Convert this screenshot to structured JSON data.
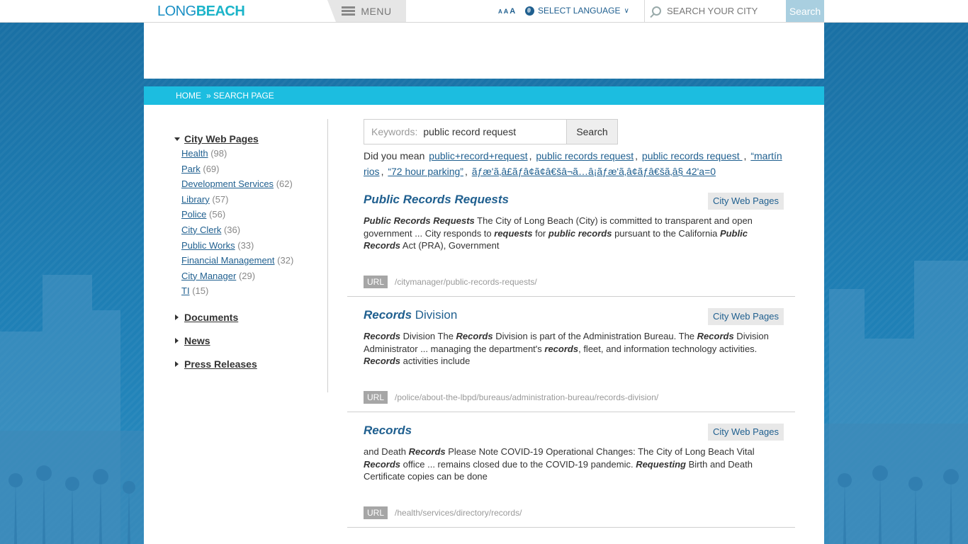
{
  "header": {
    "logo_part1": "LONG",
    "logo_part2": "BEACH",
    "menu_label": "MENU",
    "text_size": [
      "A",
      "A",
      "A"
    ],
    "language_label": "SELECT LANGUAGE",
    "search_placeholder": "SEARCH YOUR CITY",
    "search_button": "Search"
  },
  "breadcrumb": {
    "home": "HOME",
    "current": "» SEARCH PAGE"
  },
  "sidebar": {
    "facets": [
      {
        "label": "City Web Pages",
        "expanded": true,
        "items": [
          {
            "label": "Health",
            "count": "(98)"
          },
          {
            "label": "Park",
            "count": "(69)"
          },
          {
            "label": "Development Services",
            "count": "(62)"
          },
          {
            "label": "Library",
            "count": "(57)"
          },
          {
            "label": "Police",
            "count": "(56)"
          },
          {
            "label": "City Clerk",
            "count": "(36)"
          },
          {
            "label": "Public Works",
            "count": "(33)"
          },
          {
            "label": "Financial Management",
            "count": "(32)"
          },
          {
            "label": "City Manager",
            "count": "(29)"
          },
          {
            "label": "TI",
            "count": "(15)"
          }
        ]
      },
      {
        "label": "Documents",
        "expanded": false
      },
      {
        "label": "News",
        "expanded": false
      },
      {
        "label": "Press Releases",
        "expanded": false
      }
    ]
  },
  "search": {
    "keywords_label": "Keywords:",
    "value": "public record request",
    "button": "Search",
    "did_you_mean_label": "Did you mean",
    "suggestions": [
      "public+record+request",
      "public records request",
      "public records request ",
      "“martín rios",
      "“72 hour parking”",
      "ãƒæ'ã‚â£ãƒâ¢ã¢â€šâ¬ã…â¡ãƒæ'ã‚â¢ãƒâ€šã‚â§ 42'a=0"
    ]
  },
  "results": [
    {
      "title_bold": "Public Records Requests",
      "title_rest": "",
      "category": "City Web Pages",
      "snippet": [
        {
          "b": "Public Records Requests"
        },
        {
          "t": " The City of Long Beach (City) is committed to transparent and open government ... City responds to "
        },
        {
          "b": "requests"
        },
        {
          "t": " for "
        },
        {
          "b": "public records"
        },
        {
          "t": " pursuant to the California "
        },
        {
          "b": "Public Records"
        },
        {
          "t": " Act (PRA), Government"
        }
      ],
      "url_label": "URL",
      "url": "/citymanager/public-records-requests/"
    },
    {
      "title_bold": "Records",
      "title_rest": " Division",
      "category": "City Web Pages",
      "snippet": [
        {
          "b": "Records"
        },
        {
          "t": " Division The "
        },
        {
          "b": "Records"
        },
        {
          "t": " Division is part of the Administration Bureau. The "
        },
        {
          "b": "Records"
        },
        {
          "t": " Division Administrator ... managing the department's "
        },
        {
          "b": "records"
        },
        {
          "t": ", fleet, and information technology activities. "
        },
        {
          "b": "Records"
        },
        {
          "t": " activities include"
        }
      ],
      "url_label": "URL",
      "url": "/police/about-the-lbpd/bureaus/administration-bureau/records-division/"
    },
    {
      "title_bold": "Records",
      "title_rest": "",
      "category": "City Web Pages",
      "snippet": [
        {
          "t": "and Death "
        },
        {
          "b": "Records"
        },
        {
          "t": " Please Note COVID-19 Operational Changes: The City of Long Beach Vital "
        },
        {
          "b": "Records"
        },
        {
          "t": " office ... remains closed due to the COVID-19 pandemic.  "
        },
        {
          "b": "Requesting"
        },
        {
          "t": " Birth and Death Certificate copies can be done"
        }
      ],
      "url_label": "URL",
      "url": "/health/services/directory/records/"
    }
  ],
  "colors": {
    "accent": "#1cbde0",
    "link": "#1f5f8f",
    "background": "#1c74a8"
  }
}
